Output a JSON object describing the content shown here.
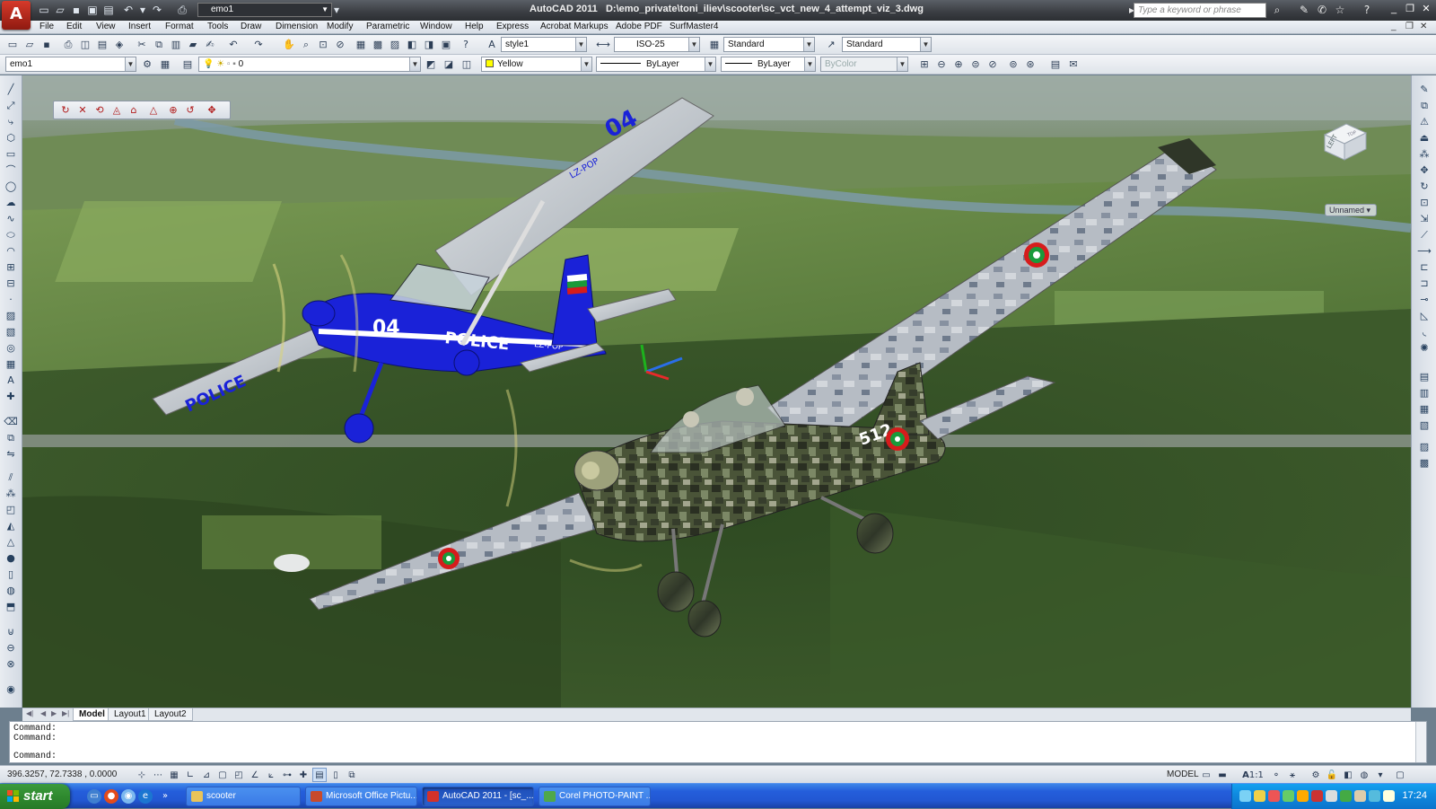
{
  "title": {
    "app": "AutoCAD 2011",
    "file": "D:\\emo_private\\toni_iliev\\scooter\\sc_vct_new_4_attempt_viz_3.dwg",
    "workspace": "emo1",
    "search_placeholder": "Type a keyword or phrase"
  },
  "menu": [
    "File",
    "Edit",
    "View",
    "Insert",
    "Format",
    "Tools",
    "Draw",
    "Dimension",
    "Modify",
    "Parametric",
    "Window",
    "Help",
    "Express",
    "Acrobat Markups",
    "Adobe PDF",
    "SurfMaster4"
  ],
  "toolbar1": {
    "text_style": "style1",
    "dim_style": "ISO-25",
    "table_style": "Standard",
    "multileader_style": "Standard"
  },
  "toolbar2": {
    "ucs_name": "emo1",
    "layer": "0",
    "color": "Yellow",
    "linetype": "ByLayer",
    "lineweight": "ByLayer",
    "plotstyle": "ByColor"
  },
  "viewcube": {
    "face": "LEFT",
    "top": "TOP",
    "ucs_menu": "Unnamed"
  },
  "aircraft": {
    "blue": {
      "tail_number": "04",
      "marking": "POLICE",
      "registration": "LZ-POP"
    },
    "camo": {
      "number": "512"
    }
  },
  "layout_tabs": [
    "Model",
    "Layout1",
    "Layout2"
  ],
  "command": {
    "history": [
      "Command:",
      "Command:"
    ],
    "prompt": "Command:"
  },
  "status": {
    "coordinates": "396.3257, 72.7338 , 0.0000",
    "space": "MODEL",
    "annotation_scale": "1:1"
  },
  "taskbar": {
    "start": "start",
    "tasks": [
      "scooter",
      "Microsoft Office Pictu...",
      "AutoCAD 2011 - [sc_...",
      "Corel PHOTO-PAINT ..."
    ],
    "active_task": "AutoCAD 2011 - [sc_...",
    "clock": "17:24"
  },
  "colors": {
    "taskbar_blue": "#245edb",
    "start_green": "#2f8a2f",
    "police_blue": "#1a22d8",
    "selected_color": "#ffff00"
  }
}
